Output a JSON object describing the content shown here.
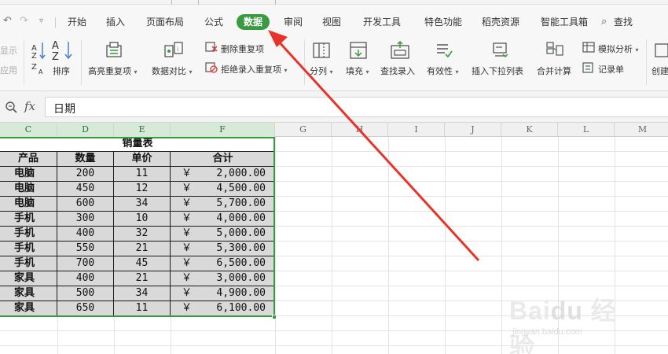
{
  "menubar": {
    "items": [
      "开始",
      "插入",
      "页面布局",
      "公式",
      "数据",
      "审阅",
      "视图",
      "开发工具",
      "特色功能",
      "稻壳资源",
      "智能工具箱"
    ],
    "active": "数据",
    "search_label": "查找"
  },
  "ribbon": {
    "show_label_cut": "显示",
    "apply_label_cut": "应用",
    "sort_label": "排序",
    "highlight_dup_label": "高亮重复项",
    "compare_label": "数据对比",
    "remove_dup_label": "删除重复项",
    "reject_dup_label": "拒绝录入重复项",
    "split_label": "分列",
    "fill_label": "填充",
    "lookup_label": "查找录入",
    "validity_label": "有效性",
    "dropdown_label": "插入下拉列表",
    "consolidate_label": "合并计算",
    "simulate_label": "模拟分析",
    "record_label": "记录单",
    "create_label_cut": "创建"
  },
  "formula_bar": {
    "fx": "fx",
    "value": "日期"
  },
  "columns": [
    "C",
    "D",
    "E",
    "F",
    "G",
    "H",
    "I",
    "J",
    "K",
    "L",
    "M"
  ],
  "sheet": {
    "title": "销量表",
    "headers": [
      "产品",
      "数量",
      "单价",
      "合计"
    ],
    "currency": "￥",
    "rows": [
      {
        "name": "电脑",
        "qty": "200",
        "price": "11",
        "total": "2,000.00"
      },
      {
        "name": "电脑",
        "qty": "450",
        "price": "12",
        "total": "4,500.00"
      },
      {
        "name": "电脑",
        "qty": "600",
        "price": "34",
        "total": "5,700.00"
      },
      {
        "name": "手机",
        "qty": "300",
        "price": "10",
        "total": "4,000.00"
      },
      {
        "name": "手机",
        "qty": "400",
        "price": "32",
        "total": "5,000.00"
      },
      {
        "name": "手机",
        "qty": "550",
        "price": "21",
        "total": "5,300.00"
      },
      {
        "name": "手机",
        "qty": "700",
        "price": "45",
        "total": "6,500.00"
      },
      {
        "name": "家具",
        "qty": "400",
        "price": "21",
        "total": "3,000.00"
      },
      {
        "name": "家具",
        "qty": "500",
        "price": "34",
        "total": "4,900.00"
      },
      {
        "name": "家具",
        "qty": "650",
        "price": "11",
        "total": "6,100.00"
      }
    ]
  },
  "colors": {
    "accent": "#3a9a3f",
    "arrow": "#e8332a"
  }
}
